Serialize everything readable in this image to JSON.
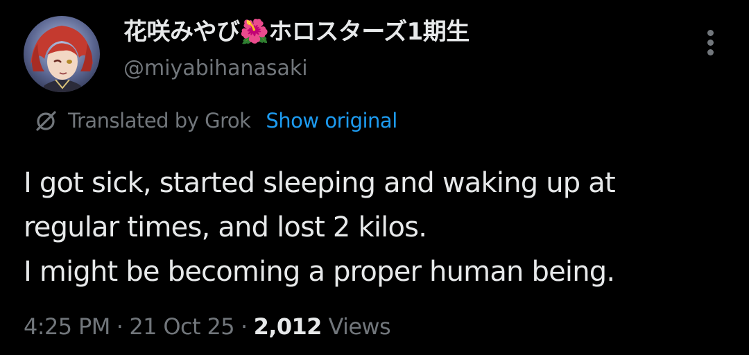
{
  "tweet": {
    "author": {
      "display_name": "花咲みやび🌺ホロスターズ1期生",
      "handle": "@miyabihanasaki",
      "avatar_icon": "avatar-image"
    },
    "more_icon": "more-vertical-icon",
    "translation": {
      "label": "Translated by Grok",
      "show_original": "Show original",
      "icon": "grok-icon"
    },
    "text_lines": [
      "I got sick, started sleeping and waking up at",
      "regular times, and lost 2 kilos.",
      "I might be becoming a proper human being."
    ],
    "meta": {
      "time": "4:25 PM",
      "separator": "·",
      "date": "21 Oct 25",
      "views_count": "2,012",
      "views_label": "Views"
    },
    "colors": {
      "background": "#000000",
      "text": "#e7e9ea",
      "secondary": "#71767b",
      "link": "#1d9bf0"
    }
  }
}
